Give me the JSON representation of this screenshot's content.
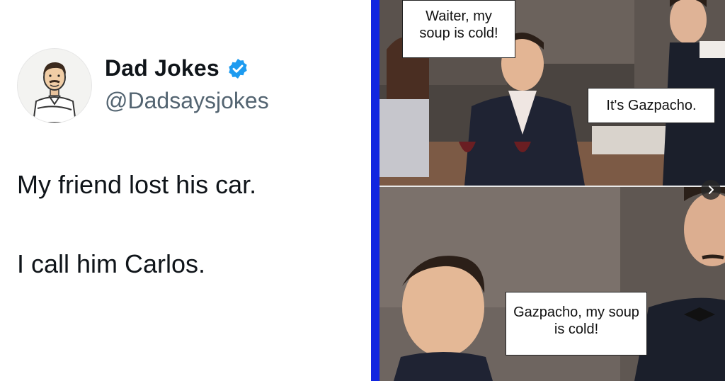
{
  "tweet": {
    "display_name": "Dad Jokes",
    "handle": "@Dadsaysjokes",
    "line1": "My friend lost his car.",
    "line2": "I call him Carlos."
  },
  "meme": {
    "bubble_top_left": "Waiter, my soup is cold!",
    "bubble_top_right": "It's Gazpacho.",
    "bubble_bottom": "Gazpacho, my soup is cold!"
  },
  "icons": {
    "verified": "verified-badge-icon",
    "next": "chevron-right-icon"
  },
  "colors": {
    "verified_blue": "#1d9bf0",
    "divider_blue": "#1226e0"
  }
}
